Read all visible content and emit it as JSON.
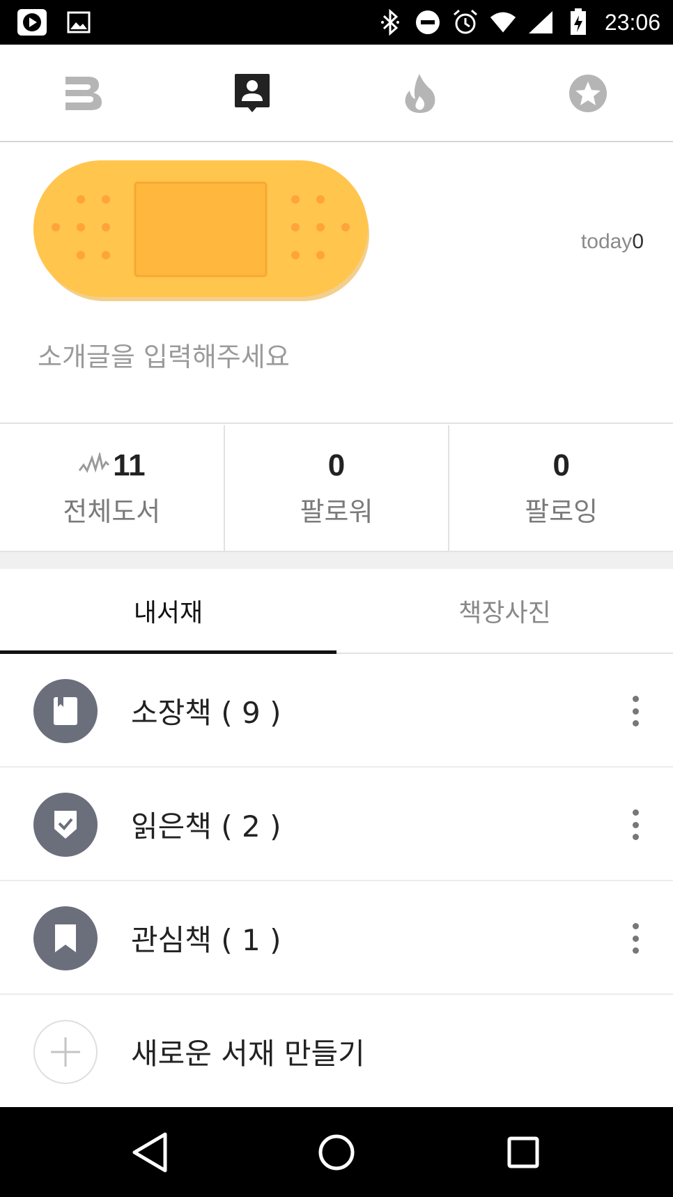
{
  "status_bar": {
    "time": "23:06",
    "left_icons": [
      "play-store-icon",
      "image-icon"
    ],
    "right_icons": [
      "bluetooth-icon",
      "do-not-disturb-icon",
      "alarm-icon",
      "wifi-icon",
      "signal-icon",
      "battery-charging-icon"
    ]
  },
  "top_nav": {
    "items": [
      "brand-b-icon",
      "profile-icon",
      "fire-icon",
      "star-icon"
    ],
    "active_index": 1,
    "active_color": "#222222",
    "inactive_color": "#b5b5b5"
  },
  "profile": {
    "today_label": "today",
    "today_count": "0",
    "intro_placeholder": "소개글을 입력해주세요",
    "avatar_color": "#FFC54D"
  },
  "stats": [
    {
      "value": "11",
      "label": "전체도서"
    },
    {
      "value": "0",
      "label": "팔로워"
    },
    {
      "value": "0",
      "label": "팔로잉"
    }
  ],
  "tabs": [
    {
      "label": "내서재",
      "active": true
    },
    {
      "label": "책장사진",
      "active": false
    }
  ],
  "shelves": [
    {
      "label": "소장책 ( 9 )",
      "icon": "book-icon"
    },
    {
      "label": "읽은책 ( 2 )",
      "icon": "check-badge-icon"
    },
    {
      "label": "관심책 ( 1 )",
      "icon": "bookmark-icon"
    }
  ],
  "new_shelf_label": "새로운 서재 만들기",
  "nav_bar": {
    "buttons": [
      "back-icon",
      "home-icon",
      "recents-icon"
    ]
  }
}
